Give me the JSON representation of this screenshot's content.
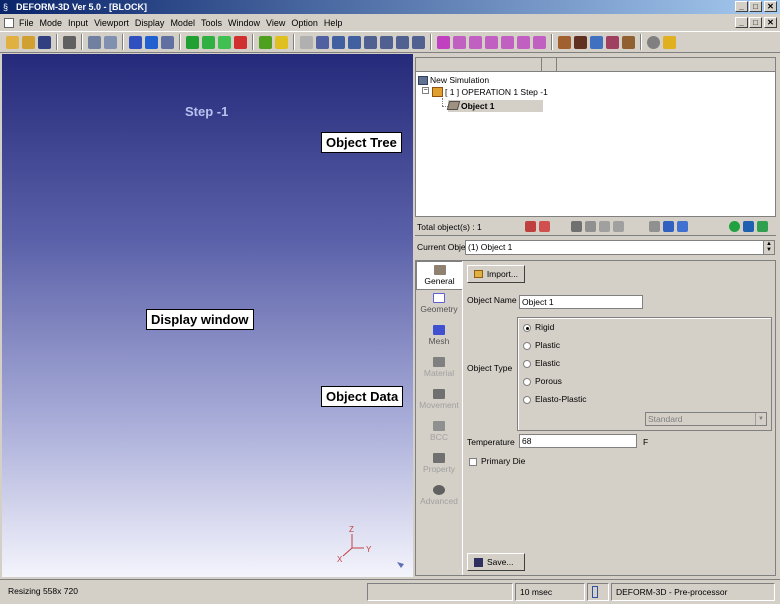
{
  "window": {
    "title": "DEFORM-3D  Ver 5.0 - [BLOCK]",
    "minimize_label": "_",
    "restore_label": "□",
    "close_label": "✕",
    "doc_minimize_label": "_",
    "doc_restore_label": "□",
    "doc_close_label": "✕"
  },
  "menu": {
    "items": [
      "File",
      "Mode",
      "Input",
      "Viewport",
      "Display",
      "Model",
      "Tools",
      "Window",
      "View",
      "Option",
      "Help"
    ]
  },
  "display": {
    "step_label": "Step   -1",
    "axis_z": "Z",
    "axis_y": "Y",
    "axis_x": "X"
  },
  "callouts": {
    "object_tree": "Object Tree",
    "display_window": "Display window",
    "object_data": "Object Data"
  },
  "tree": {
    "root": "New Simulation",
    "operation": "[ 1 ]  OPERATION 1  Step -1",
    "object": "Object 1"
  },
  "stats": {
    "total_objects": "Total object(s) : 1"
  },
  "current_object": {
    "label": "Current Objec",
    "value": "(1) Object 1"
  },
  "tabs": [
    {
      "label": "General",
      "state": "active",
      "icon": "general-icon"
    },
    {
      "label": "Geometry",
      "state": "normal",
      "icon": "geometry-icon"
    },
    {
      "label": "Mesh",
      "state": "normal",
      "icon": "mesh-icon"
    },
    {
      "label": "Material",
      "state": "disabled",
      "icon": "material-icon"
    },
    {
      "label": "Movement",
      "state": "disabled",
      "icon": "movement-icon"
    },
    {
      "label": "BCC",
      "state": "disabled",
      "icon": "bcc-icon"
    },
    {
      "label": "Property",
      "state": "disabled",
      "icon": "property-icon"
    },
    {
      "label": "Advanced",
      "state": "disabled",
      "icon": "advanced-icon"
    }
  ],
  "general": {
    "import_label": "Import...",
    "object_name_label": "Object Name",
    "object_name_value": "Object 1",
    "object_type_label": "Object Type",
    "types": [
      "Rigid",
      "Plastic",
      "Elastic",
      "Porous",
      "Elasto-Plastic"
    ],
    "selected_type": "Rigid",
    "standard_value": "Standard",
    "temperature_label": "Temperature",
    "temperature_value": "68",
    "temperature_unit": "F",
    "primary_die_label": "Primary Die",
    "save_label": "Save..."
  },
  "status": {
    "resizing": "Resizing  558x 720",
    "time": "10 msec",
    "mode": "DEFORM-3D  -  Pre-processor"
  },
  "colors": {
    "titlebar": "#0a246a",
    "display_top": "#252a7a",
    "display_bottom": "#f4f4fc",
    "step_text": "#b7c3ee"
  }
}
